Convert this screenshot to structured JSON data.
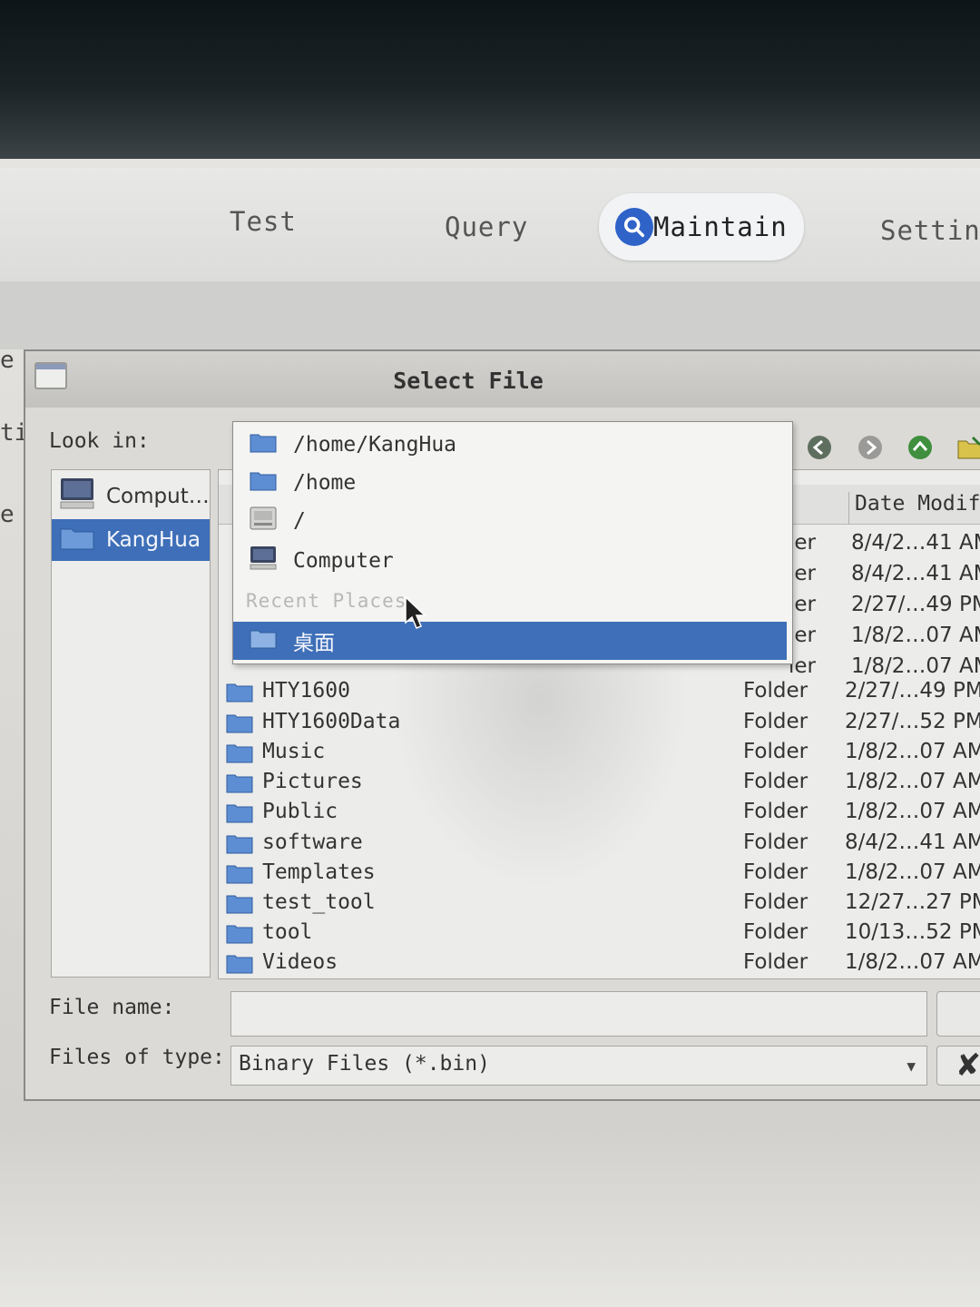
{
  "topnav": {
    "tabs": [
      {
        "label": "Test"
      },
      {
        "label": "Query"
      },
      {
        "label": "Maintain",
        "active": true
      },
      {
        "label": "Setting"
      }
    ],
    "accent_color": "#2f63c8"
  },
  "side_fragments": [
    "e",
    "ti",
    "e"
  ],
  "dialog": {
    "title": "Select File",
    "look_in_label": "Look in:",
    "file_name_label": "File name:",
    "file_name_value": "",
    "files_of_type_label": "Files of type:",
    "files_of_type_value": "Binary Files (*.bin)",
    "cancel_icon": "close-icon",
    "selection_color": "#3e6fb8"
  },
  "places": [
    {
      "label": "Comput…",
      "icon": "computer-icon"
    },
    {
      "label": "KangHua",
      "icon": "folder-icon",
      "selected": true
    }
  ],
  "look_in_popup": {
    "items": [
      {
        "label": "/home/KangHua",
        "icon": "folder-icon"
      },
      {
        "label": "/home",
        "icon": "folder-icon"
      },
      {
        "label": "/",
        "icon": "drive-icon"
      },
      {
        "label": "Computer",
        "icon": "computer-icon"
      }
    ],
    "section_label": "Recent Places",
    "recent": [
      {
        "label": "桌面",
        "icon": "folder-icon",
        "selected": true
      }
    ]
  },
  "file_list": {
    "date_header": "Date Modifi",
    "hidden_rows": [
      {
        "type": "ler",
        "date": "8/4/2…41 AM"
      },
      {
        "type": "ler",
        "date": "8/4/2…41 AM"
      },
      {
        "type": "ler",
        "date": "2/27/…49 PM"
      },
      {
        "type": "ler",
        "date": "1/8/2…07 AM"
      },
      {
        "type": "ler",
        "date": "1/8/2…07 AM"
      }
    ],
    "rows": [
      {
        "name": "HTY1600",
        "type": "Folder",
        "date": "2/27/…49 PM"
      },
      {
        "name": "HTY1600Data",
        "type": "Folder",
        "date": "2/27/…52 PM"
      },
      {
        "name": "Music",
        "type": "Folder",
        "date": "1/8/2…07 AM"
      },
      {
        "name": "Pictures",
        "type": "Folder",
        "date": "1/8/2…07 AM"
      },
      {
        "name": "Public",
        "type": "Folder",
        "date": "1/8/2…07 AM"
      },
      {
        "name": "software",
        "type": "Folder",
        "date": "8/4/2…41 AM"
      },
      {
        "name": "Templates",
        "type": "Folder",
        "date": "1/8/2…07 AM"
      },
      {
        "name": "test_tool",
        "type": "Folder",
        "date": "12/27…27 PM"
      },
      {
        "name": "tool",
        "type": "Folder",
        "date": "10/13…52 PM"
      },
      {
        "name": "Videos",
        "type": "Folder",
        "date": "1/8/2…07 AM"
      }
    ]
  }
}
